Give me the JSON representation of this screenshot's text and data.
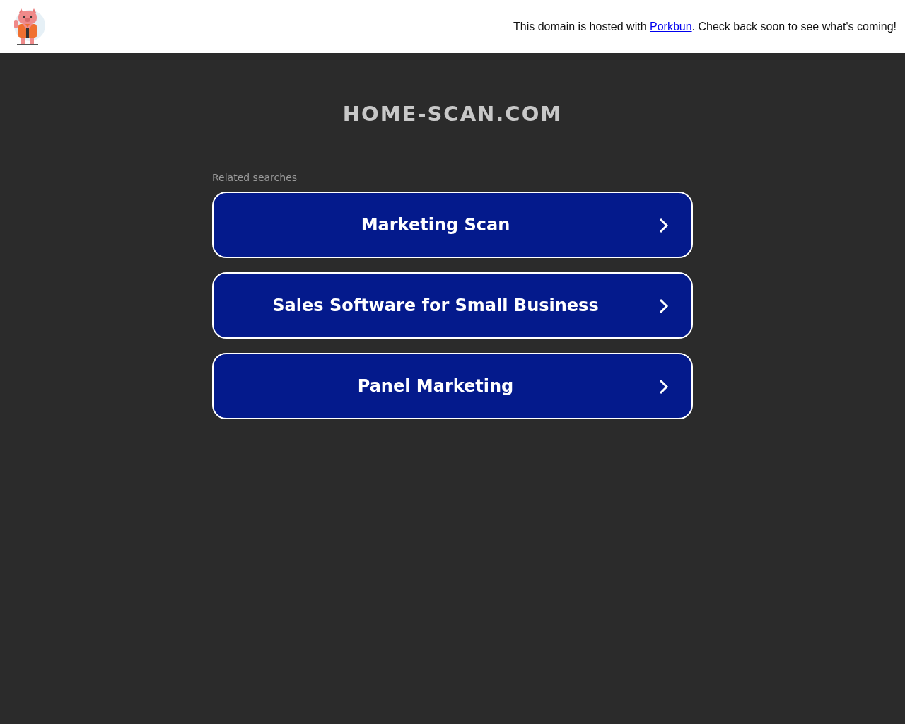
{
  "header": {
    "notice_before": "This domain is hosted with ",
    "notice_link": "Porkbun",
    "notice_after": ". Check back soon to see what's coming!"
  },
  "domain_title": "HOME-SCAN.COM",
  "related": {
    "label": "Related searches",
    "items": [
      {
        "label": "Marketing Scan"
      },
      {
        "label": "Sales Software for Small Business"
      },
      {
        "label": "Panel Marketing"
      }
    ]
  }
}
